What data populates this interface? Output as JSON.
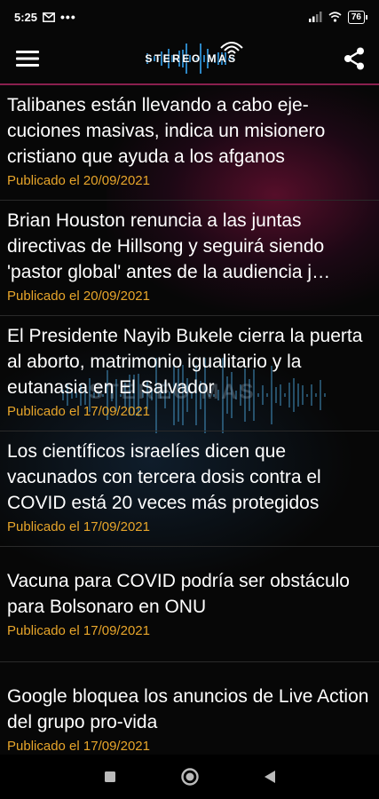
{
  "status_bar": {
    "time": "5:25",
    "battery": "76"
  },
  "app_bar": {
    "logo_text": "STEREO MAS"
  },
  "background": {
    "watermark_text": "STEREO MAS"
  },
  "news": [
    {
      "title": "Talibanes están llevando a cabo eje-cuciones masivas, indica un misionero cristiano que ayuda a los afganos",
      "date": "Publicado el 20/09/2021"
    },
    {
      "title": "Brian Houston renuncia a las juntas directivas de Hillsong y seguirá siendo 'pastor global' antes de la audiencia j…",
      "date": "Publicado el 20/09/2021"
    },
    {
      "title": "El Presidente Nayib Bukele cierra la puerta al aborto, matrimonio igualitario y la eutanasia en El Salvador",
      "date": "Publicado el 17/09/2021"
    },
    {
      "title": "Los científicos israelíes dicen que vacunados con tercera dosis contra el COVID está 20 veces más protegidos",
      "date": "Publicado el 17/09/2021"
    },
    {
      "title": "Vacuna para COVID podría ser obstáculo para Bolsonaro en ONU",
      "date": "Publicado el 17/09/2021"
    },
    {
      "title": "Google bloquea los anuncios de Live Action del grupo pro-vida",
      "date": "Publicado el 17/09/2021"
    }
  ],
  "colors": {
    "accent_line": "#8a1f4e",
    "date_text": "#e7a52a"
  },
  "icons": {
    "menu": "hamburger-menu-icon",
    "share": "share-icon",
    "nav_recents": "square-icon",
    "nav_home": "circle-icon",
    "nav_back": "triangle-back-icon"
  }
}
